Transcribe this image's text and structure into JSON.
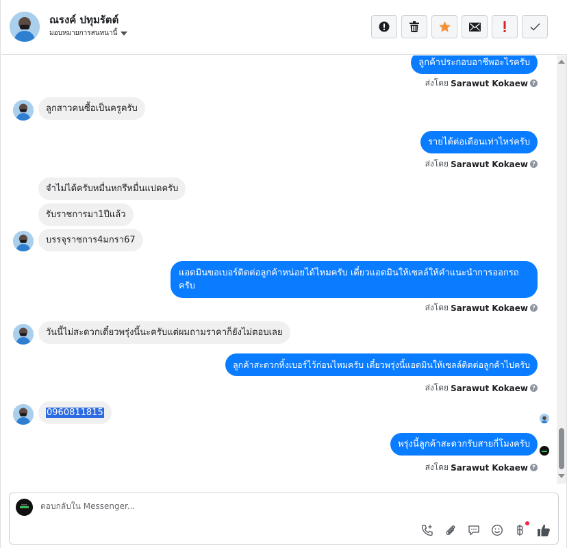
{
  "header": {
    "name": "ณรงค์ ปทุมรัตต์",
    "subtitle": "มอบหมายการสนทนานี้",
    "actions": [
      {
        "icon": "info-icon"
      },
      {
        "icon": "trash-icon"
      },
      {
        "icon": "star-icon"
      },
      {
        "icon": "mail-icon"
      },
      {
        "icon": "exclamation-icon"
      },
      {
        "icon": "check-icon"
      }
    ]
  },
  "messages": [
    {
      "dir": "out",
      "text": "ลูกค้าประกอบอาชีพอะไรครับ",
      "sent_by": "ส่งโดย",
      "agent": "Sarawut Kokaew"
    },
    {
      "dir": "in",
      "text": "ลูกสาวคนซื้อเป็นครูครับ"
    },
    {
      "dir": "out",
      "text": "รายได้ต่อเดือนเท่าไหร่ครับ",
      "sent_by": "ส่งโดย",
      "agent": "Sarawut Kokaew"
    },
    {
      "dir": "in",
      "text": "จำไม่ได้ครับหมื่นหกรึหมื่นแปดครับ"
    },
    {
      "dir": "in",
      "text": "รับราชการมา1ปีแล้ว"
    },
    {
      "dir": "in",
      "text": "บรรจุราชการ4มกรา67"
    },
    {
      "dir": "out",
      "text": "แอดมินขอเบอร์ติดต่อลูกค้าหน่อยได้ไหมครับ เดี๋ยวแอดมินให้เซลล์ให้คำแนะนำการออกรถครับ",
      "sent_by": "ส่งโดย",
      "agent": "Sarawut Kokaew"
    },
    {
      "dir": "in",
      "text": "วันนี้ไม่สะดวกเดี๋ยวพรุ่งนี้นะครับแต่ผมถามราคาก็ยังไม่ตอบเลย"
    },
    {
      "dir": "out",
      "text": "ลูกค้าสะดวกทิ้งเบอร์ไว้ก่อนไหมครับ เดี๋ยวพรุ่งนี้แอดมินให้เซลล์ติดต่อลูกค้าไปครับ",
      "sent_by": "ส่งโดย",
      "agent": "Sarawut Kokaew"
    },
    {
      "dir": "in",
      "text": "0960811815"
    },
    {
      "dir": "out",
      "text": "พรุ่งนี้ลูกค้าสะดวกรับสายกี่โมงครับ",
      "sent_by": "ส่งโดย",
      "agent": "Sarawut Kokaew"
    }
  ],
  "composer": {
    "placeholder": "ตอบกลับใน Messenger...",
    "tools": [
      "phone-add-icon",
      "paperclip-icon",
      "saved-reply-icon",
      "emoji-icon",
      "baht-icon",
      "like-icon"
    ]
  },
  "colors": {
    "outgoing_bubble": "#0a7cff",
    "incoming_bubble": "#f0f0f0",
    "star": "#f7923b",
    "exclamation": "#e02020",
    "selection": "#2d6be0"
  }
}
